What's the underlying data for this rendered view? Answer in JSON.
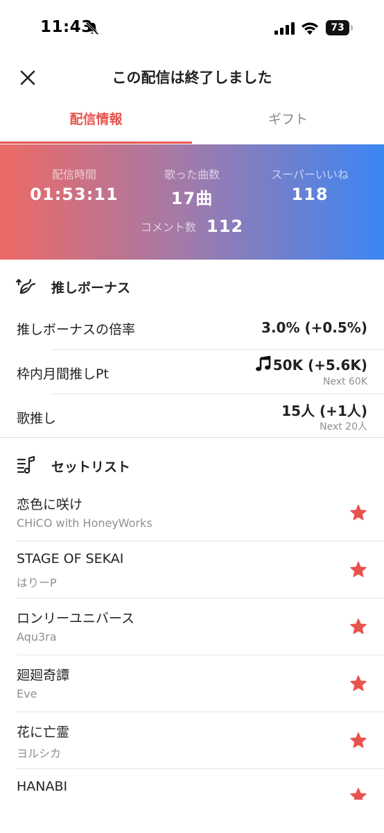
{
  "status_bar": {
    "time": "11:43",
    "battery": "73"
  },
  "header": {
    "title": "この配信は終了しました",
    "close_icon": "close-icon"
  },
  "tabs": [
    {
      "label": "配信情報",
      "active": true
    },
    {
      "label": "ギフト",
      "active": false
    }
  ],
  "stats": {
    "duration": {
      "label": "配信時間",
      "value": "01:53:11"
    },
    "songs": {
      "label": "歌った曲数",
      "value": "17曲"
    },
    "super_likes": {
      "label": "スーパーいいね",
      "value": "118"
    },
    "comments": {
      "label": "コメント数",
      "value": "112"
    }
  },
  "bonus_section": {
    "title": "推しボーナス",
    "icon": "bonus-bird-icon",
    "rows": [
      {
        "label": "推しボーナスの倍率",
        "value": "3.0% (+0.5%)",
        "sub": ""
      },
      {
        "label": "枠内月間推しPt",
        "value": "50K (+5.6K)",
        "sub": "Next 60K"
      },
      {
        "label": "歌推し",
        "value": "15人 (+1人)",
        "sub": "Next 20人"
      }
    ]
  },
  "setlist_section": {
    "title": "セットリスト",
    "icon": "setlist-icon",
    "songs": [
      {
        "title": "恋色に咲け",
        "artist": "CHiCO with HoneyWorks"
      },
      {
        "title": "STAGE OF SEKAI",
        "artist": "はりーP"
      },
      {
        "title": "ロンリーユニバース",
        "artist": "Aqu3ra"
      },
      {
        "title": "廻廻奇譚",
        "artist": "Eve"
      },
      {
        "title": "花に亡霊",
        "artist": "ヨルシカ"
      },
      {
        "title": "HANABI",
        "artist": ""
      }
    ]
  },
  "colors": {
    "accent": "#e8534f",
    "gradient_start": "#ec6a65",
    "gradient_end": "#3b86f4",
    "star": "#e8534f"
  }
}
